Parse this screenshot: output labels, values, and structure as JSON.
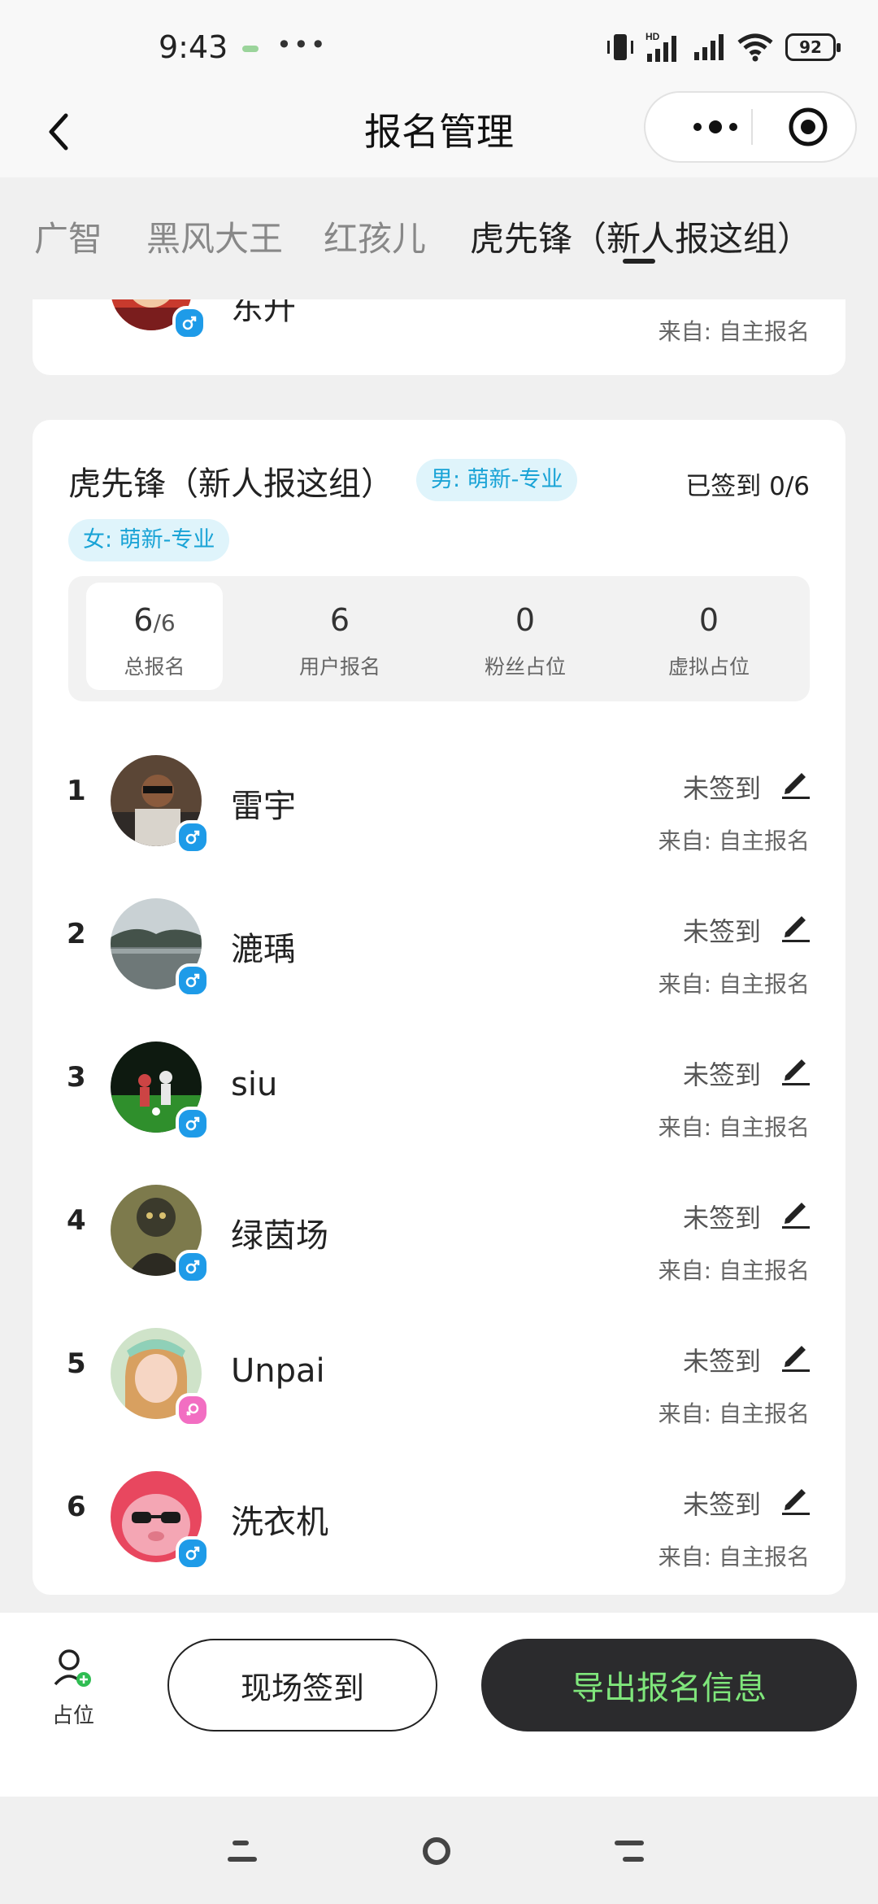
{
  "status_bar": {
    "time": "9:43",
    "dots": "•••",
    "network_label": "HD",
    "battery": "92"
  },
  "nav": {
    "title": "报名管理",
    "back_icon": "chevron-left-icon",
    "more_icon": "more-dots-icon",
    "close_icon": "target-circle-icon"
  },
  "tabs": [
    {
      "label": "广智",
      "active": false
    },
    {
      "label": "黑风大王",
      "active": false
    },
    {
      "label": "红孩儿",
      "active": false
    },
    {
      "label": "虎先锋（新人报这组）",
      "active": true
    }
  ],
  "previous_card": {
    "name_fragment": "东升",
    "source": "来自: 自主报名"
  },
  "group": {
    "title": "虎先锋（新人报这组）",
    "tag_male": "男: 萌新-专业",
    "tag_female": "女: 萌新-专业",
    "checked_in": "已签到 0/6",
    "stats": [
      {
        "value": "6",
        "sub": "/6",
        "label": "总报名",
        "selected": true
      },
      {
        "value": "6",
        "sub": "",
        "label": "用户报名",
        "selected": false
      },
      {
        "value": "0",
        "sub": "",
        "label": "粉丝占位",
        "selected": false
      },
      {
        "value": "0",
        "sub": "",
        "label": "虚拟占位",
        "selected": false
      }
    ],
    "members": [
      {
        "index": "1",
        "name": "雷宇",
        "gender": "male",
        "status": "未签到",
        "source": "来自: 自主报名"
      },
      {
        "index": "2",
        "name": "漉瑀",
        "gender": "male",
        "status": "未签到",
        "source": "来自: 自主报名"
      },
      {
        "index": "3",
        "name": "siu",
        "gender": "male",
        "status": "未签到",
        "source": "来自: 自主报名"
      },
      {
        "index": "4",
        "name": "绿茵场",
        "gender": "male",
        "status": "未签到",
        "source": "来自: 自主报名"
      },
      {
        "index": "5",
        "name": "Unpai",
        "gender": "female",
        "status": "未签到",
        "source": "来自: 自主报名"
      },
      {
        "index": "6",
        "name": "洗衣机",
        "gender": "male",
        "status": "未签到",
        "source": "来自: 自主报名"
      }
    ]
  },
  "bottom": {
    "placeholder_label": "占位",
    "signin_label": "现场签到",
    "export_label": "导出报名信息"
  },
  "colors": {
    "tag_bg": "#dff4fb",
    "tag_text": "#19a3d6",
    "male": "#1e9be8",
    "female": "#f26ec2",
    "export_bg": "#2b2b2d",
    "export_text": "#7fe67b"
  }
}
